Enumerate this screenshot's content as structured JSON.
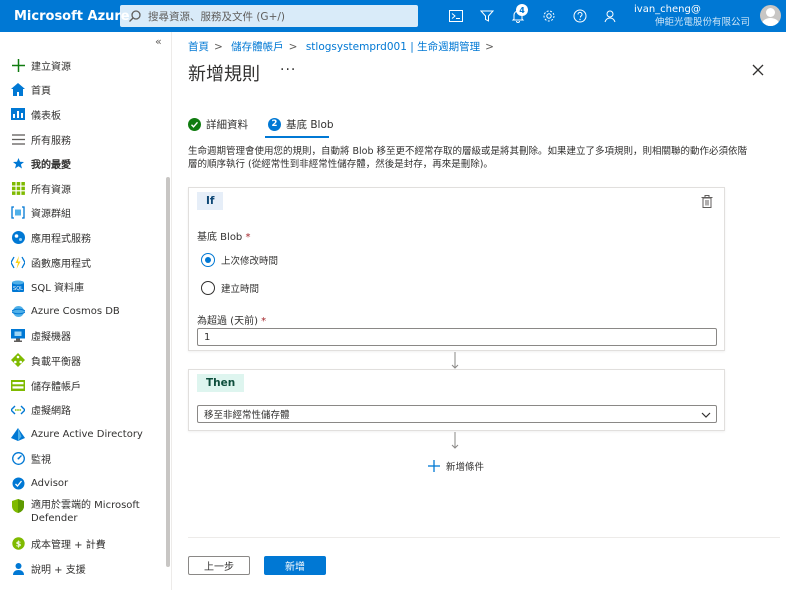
{
  "topbar": {
    "brand": "Microsoft Azure",
    "search_placeholder": "搜尋資源、服務及文件 (G+/)",
    "notification_count": "4",
    "user_name": "ivan_cheng@",
    "user_org": "伸鉅光電股份有限公司"
  },
  "sidebar": {
    "collapse": "«",
    "items": [
      {
        "label": "建立資源",
        "icon": "plus-icon"
      },
      {
        "label": "首頁",
        "icon": "home-icon"
      },
      {
        "label": "儀表板",
        "icon": "dashboard-icon"
      },
      {
        "label": "所有服務",
        "icon": "list-icon"
      },
      {
        "label": "我的最愛",
        "icon": "star-icon"
      },
      {
        "label": "所有資源",
        "icon": "grid-icon"
      },
      {
        "label": "資源群組",
        "icon": "resource-group-icon"
      },
      {
        "label": "應用程式服務",
        "icon": "app-service-icon"
      },
      {
        "label": "函數應用程式",
        "icon": "function-icon"
      },
      {
        "label": "SQL 資料庫",
        "icon": "sql-icon"
      },
      {
        "label": "Azure Cosmos DB",
        "icon": "cosmos-icon"
      },
      {
        "label": "虛擬機器",
        "icon": "vm-icon"
      },
      {
        "label": "負載平衡器",
        "icon": "load-balancer-icon"
      },
      {
        "label": "儲存體帳戶",
        "icon": "storage-icon"
      },
      {
        "label": "虛擬網路",
        "icon": "vnet-icon"
      },
      {
        "label": "Azure Active Directory",
        "icon": "aad-icon"
      },
      {
        "label": "監視",
        "icon": "monitor-icon"
      },
      {
        "label": "Advisor",
        "icon": "advisor-icon"
      },
      {
        "label": "適用於雲端的 Microsoft Defender",
        "icon": "defender-icon"
      },
      {
        "label": "成本管理 + 計費",
        "icon": "cost-icon"
      },
      {
        "label": "說明 + 支援",
        "icon": "help-icon"
      }
    ]
  },
  "breadcrumb": [
    "首頁",
    "儲存體帳戶",
    "stlogsystemprd001 | 生命週期管理"
  ],
  "page": {
    "title": "新增規則",
    "more": "···"
  },
  "steps": [
    {
      "label": "詳細資料",
      "num": ""
    },
    {
      "label": "基底 Blob",
      "num": "2"
    }
  ],
  "description": "生命週期管理會使用您的規則，自動將 Blob 移至更不經常存取的層級或是將其刪除。如果建立了多項規則，則相關聯的動作必須依階層的順序執行 (從經常性到非經常性儲存體，然後是封存，再來是刪除)。",
  "if_block": {
    "tag": "If",
    "base_blob_label": "基底 Blob",
    "required": "*",
    "radio_modified": "上次修改時間",
    "radio_created": "建立時間",
    "days_label": "為超過 (天前)",
    "days_value": "1"
  },
  "then_block": {
    "tag": "Then",
    "action_value": "移至非經常性儲存體"
  },
  "add_condition": "新增條件",
  "buttons": {
    "prev": "上一步",
    "add": "新增"
  },
  "colors": {
    "azure_blue": "#0078d4",
    "if_tag_bg": "#e6eef8",
    "then_tag_bg": "#def5ef"
  }
}
